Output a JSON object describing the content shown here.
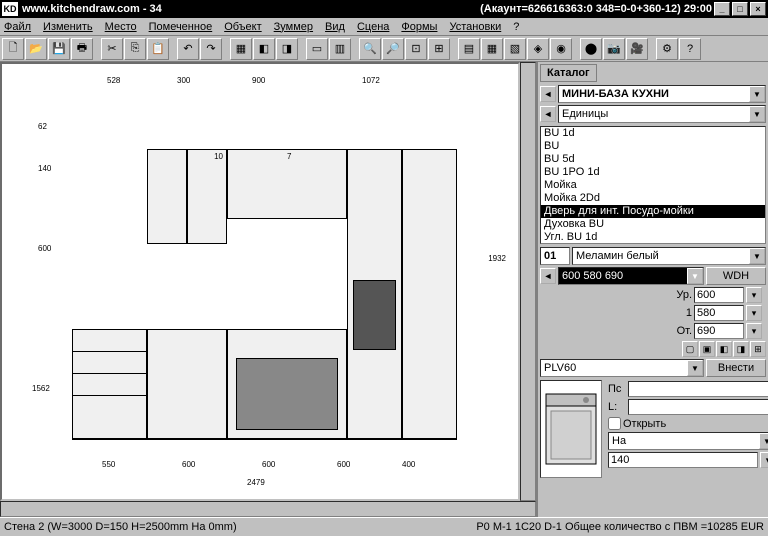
{
  "titlebar": {
    "logo": "KD",
    "title": "www.kitchendraw.com - 34",
    "account": "(Акаунт=626616363:0 348=0-0+360-12) 29:00"
  },
  "menu": {
    "file": "Файл",
    "edit": "Изменить",
    "place": "Место",
    "marked": "Помеченное",
    "object": "Объект",
    "zoom": "Зуммер",
    "view": "Вид",
    "scene": "Сцена",
    "forms": "Формы",
    "settings": "Установки",
    "help": "?"
  },
  "catalog": {
    "tab": "Каталог",
    "database": "МИНИ-БАЗА КУХНИ",
    "units_label": "Единицы",
    "items": [
      "BU 1d",
      "BU",
      "BU 5d",
      "BU 1PO 1d",
      "Мойка",
      "Мойка 2Dd",
      "Дверь для инт. Посудо-мойки",
      "Духовка BU",
      "Угл. BU 1d"
    ],
    "selected_index": 6,
    "finish_code": "01",
    "finish_name": "Меламин белый",
    "dims_selected": "600 580 690",
    "wdh_btn": "WDH",
    "width_label": "Ур.",
    "width_val": "600",
    "depth_label": "1",
    "depth_val": "580",
    "height_label": "От.",
    "height_val": "690",
    "code": "PLV60",
    "insert_btn": "Внести",
    "pl_label": "Пс",
    "l_label": "L:",
    "open_chk": "Открыть",
    "on_label": "На",
    "on_val": "140"
  },
  "drawing": {
    "top_dims": [
      "528",
      "300",
      "900",
      "1072"
    ],
    "bottom_dims": [
      "550",
      "600",
      "600",
      "600",
      "400"
    ],
    "bottom_total": "2479",
    "left_dims": [
      "62",
      "140",
      "600",
      "1562"
    ],
    "right_dim": "1932",
    "cabinet_labels": [
      "10",
      "7"
    ]
  },
  "statusbar": {
    "left": "Стена 2 (W=3000 D=150 H=2500mm На 0mm)",
    "right": "P0 M-1 1C20 D-1 Общее количество с ПВМ =10285 EUR"
  }
}
